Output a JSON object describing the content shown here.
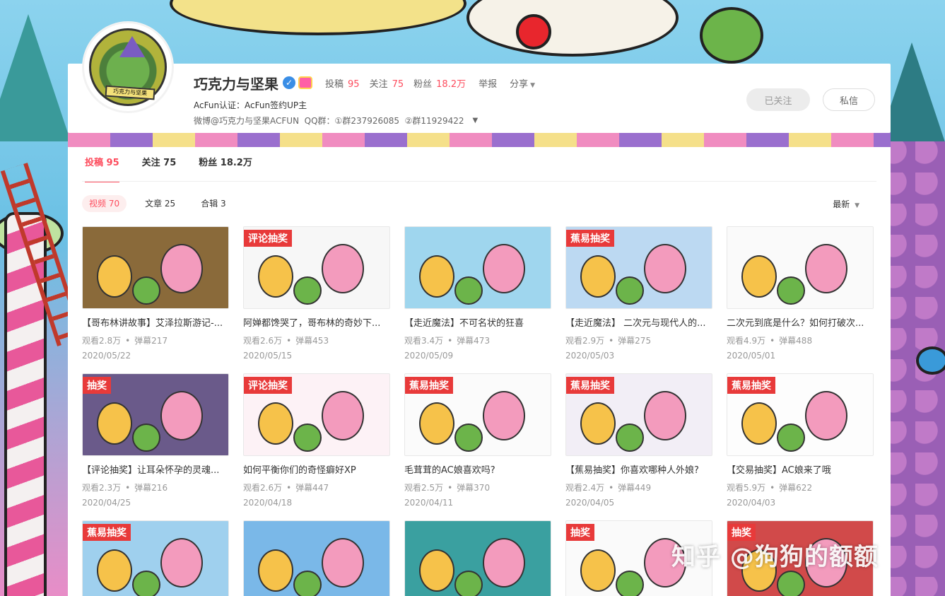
{
  "channel": {
    "name": "巧克力与坚果",
    "avatar_text": "巧克力与坚果",
    "stats": [
      {
        "label": "投稿",
        "value": "95"
      },
      {
        "label": "关注",
        "value": "75"
      },
      {
        "label": "粉丝",
        "value": "18.2万"
      }
    ],
    "report_label": "举报",
    "share_label": "分享",
    "certification": "AcFun认证：AcFun签约UP主",
    "intro": "微博@巧克力与坚果ACFUN  QQ群：①群237926085  ②群11929422",
    "followed_button": "已关注",
    "message_button": "私信"
  },
  "tabs": [
    {
      "label": "投稿 95",
      "active": true
    },
    {
      "label": "关注 75",
      "active": false
    },
    {
      "label": "粉丝 18.2万",
      "active": false
    }
  ],
  "filters": [
    {
      "label": "视频 70",
      "active": true
    },
    {
      "label": "文章 25",
      "active": false
    },
    {
      "label": "合辑 3",
      "active": false
    }
  ],
  "sort_label": "最新",
  "icons": {
    "verify": "verified-check-icon",
    "vip": "vip-badge-icon",
    "caret": "chevron-down-icon"
  },
  "videos": [
    {
      "title": "【哥布林讲故事】艾泽拉斯游记-...",
      "views": "观看2.8万",
      "danmaku": "弹幕217",
      "date": "2020/05/22",
      "tag": "",
      "color": "#8a6a3a"
    },
    {
      "title": "阿婵都馋哭了，哥布林的奇妙下...",
      "views": "观看2.6万",
      "danmaku": "弹幕453",
      "date": "2020/05/15",
      "tag": "评论抽奖",
      "color": "#f7f7f7"
    },
    {
      "title": "【走近魔法】不可名状的狂喜",
      "views": "观看3.4万",
      "danmaku": "弹幕473",
      "date": "2020/05/09",
      "tag": "",
      "color": "#9fd6ee"
    },
    {
      "title": "【走近魔法】 二次元与现代人的...",
      "views": "观看2.9万",
      "danmaku": "弹幕275",
      "date": "2020/05/03",
      "tag": "蕉易抽奖",
      "color": "#bcd9f2"
    },
    {
      "title": "二次元到底是什么？如何打破次...",
      "views": "观看4.9万",
      "danmaku": "弹幕488",
      "date": "2020/05/01",
      "tag": "",
      "color": "#fafafa"
    },
    {
      "title": "【评论抽奖】让耳朵怀孕的灵魂...",
      "views": "观看2.3万",
      "danmaku": "弹幕216",
      "date": "2020/04/25",
      "tag": "抽奖",
      "color": "#6a5a8a"
    },
    {
      "title": "如何平衡你们的奇怪癖好XP",
      "views": "观看2.6万",
      "danmaku": "弹幕447",
      "date": "2020/04/18",
      "tag": "评论抽奖",
      "color": "#fdf2f6"
    },
    {
      "title": "毛茸茸的AC娘喜欢吗?",
      "views": "观看2.5万",
      "danmaku": "弹幕370",
      "date": "2020/04/11",
      "tag": "蕉易抽奖",
      "color": "#fbfbfb"
    },
    {
      "title": "【蕉易抽奖】你喜欢哪种人外娘?",
      "views": "观看2.4万",
      "danmaku": "弹幕449",
      "date": "2020/04/05",
      "tag": "蕉易抽奖",
      "color": "#f2eef6"
    },
    {
      "title": "【交易抽奖】AC娘来了哦",
      "views": "观看5.9万",
      "danmaku": "弹幕622",
      "date": "2020/04/03",
      "tag": "蕉易抽奖",
      "color": "#fdfdfd"
    },
    {
      "title": "",
      "views": "",
      "danmaku": "",
      "date": "",
      "tag": "蕉易抽奖",
      "color": "#9fd0ee"
    },
    {
      "title": "",
      "views": "",
      "danmaku": "",
      "date": "",
      "tag": "",
      "color": "#7ab8e8"
    },
    {
      "title": "",
      "views": "",
      "danmaku": "",
      "date": "",
      "tag": "",
      "color": "#3aa0a0"
    },
    {
      "title": "",
      "views": "",
      "danmaku": "",
      "date": "",
      "tag": "抽奖",
      "color": "#fafafa"
    },
    {
      "title": "",
      "views": "",
      "danmaku": "",
      "date": "",
      "tag": "抽奖",
      "color": "#d14a4a"
    }
  ],
  "watermark": "知乎 @狗狗的额额"
}
